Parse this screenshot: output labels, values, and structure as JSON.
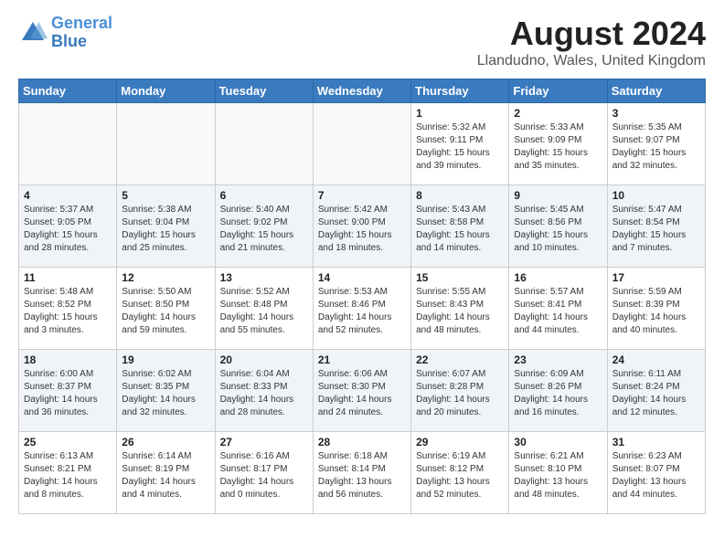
{
  "header": {
    "logo_line1": "General",
    "logo_line2": "Blue",
    "title": "August 2024",
    "subtitle": "Llandudno, Wales, United Kingdom"
  },
  "weekdays": [
    "Sunday",
    "Monday",
    "Tuesday",
    "Wednesday",
    "Thursday",
    "Friday",
    "Saturday"
  ],
  "weeks": [
    [
      {
        "day": "",
        "info": ""
      },
      {
        "day": "",
        "info": ""
      },
      {
        "day": "",
        "info": ""
      },
      {
        "day": "",
        "info": ""
      },
      {
        "day": "1",
        "info": "Sunrise: 5:32 AM\nSunset: 9:11 PM\nDaylight: 15 hours\nand 39 minutes."
      },
      {
        "day": "2",
        "info": "Sunrise: 5:33 AM\nSunset: 9:09 PM\nDaylight: 15 hours\nand 35 minutes."
      },
      {
        "day": "3",
        "info": "Sunrise: 5:35 AM\nSunset: 9:07 PM\nDaylight: 15 hours\nand 32 minutes."
      }
    ],
    [
      {
        "day": "4",
        "info": "Sunrise: 5:37 AM\nSunset: 9:05 PM\nDaylight: 15 hours\nand 28 minutes."
      },
      {
        "day": "5",
        "info": "Sunrise: 5:38 AM\nSunset: 9:04 PM\nDaylight: 15 hours\nand 25 minutes."
      },
      {
        "day": "6",
        "info": "Sunrise: 5:40 AM\nSunset: 9:02 PM\nDaylight: 15 hours\nand 21 minutes."
      },
      {
        "day": "7",
        "info": "Sunrise: 5:42 AM\nSunset: 9:00 PM\nDaylight: 15 hours\nand 18 minutes."
      },
      {
        "day": "8",
        "info": "Sunrise: 5:43 AM\nSunset: 8:58 PM\nDaylight: 15 hours\nand 14 minutes."
      },
      {
        "day": "9",
        "info": "Sunrise: 5:45 AM\nSunset: 8:56 PM\nDaylight: 15 hours\nand 10 minutes."
      },
      {
        "day": "10",
        "info": "Sunrise: 5:47 AM\nSunset: 8:54 PM\nDaylight: 15 hours\nand 7 minutes."
      }
    ],
    [
      {
        "day": "11",
        "info": "Sunrise: 5:48 AM\nSunset: 8:52 PM\nDaylight: 15 hours\nand 3 minutes."
      },
      {
        "day": "12",
        "info": "Sunrise: 5:50 AM\nSunset: 8:50 PM\nDaylight: 14 hours\nand 59 minutes."
      },
      {
        "day": "13",
        "info": "Sunrise: 5:52 AM\nSunset: 8:48 PM\nDaylight: 14 hours\nand 55 minutes."
      },
      {
        "day": "14",
        "info": "Sunrise: 5:53 AM\nSunset: 8:46 PM\nDaylight: 14 hours\nand 52 minutes."
      },
      {
        "day": "15",
        "info": "Sunrise: 5:55 AM\nSunset: 8:43 PM\nDaylight: 14 hours\nand 48 minutes."
      },
      {
        "day": "16",
        "info": "Sunrise: 5:57 AM\nSunset: 8:41 PM\nDaylight: 14 hours\nand 44 minutes."
      },
      {
        "day": "17",
        "info": "Sunrise: 5:59 AM\nSunset: 8:39 PM\nDaylight: 14 hours\nand 40 minutes."
      }
    ],
    [
      {
        "day": "18",
        "info": "Sunrise: 6:00 AM\nSunset: 8:37 PM\nDaylight: 14 hours\nand 36 minutes."
      },
      {
        "day": "19",
        "info": "Sunrise: 6:02 AM\nSunset: 8:35 PM\nDaylight: 14 hours\nand 32 minutes."
      },
      {
        "day": "20",
        "info": "Sunrise: 6:04 AM\nSunset: 8:33 PM\nDaylight: 14 hours\nand 28 minutes."
      },
      {
        "day": "21",
        "info": "Sunrise: 6:06 AM\nSunset: 8:30 PM\nDaylight: 14 hours\nand 24 minutes."
      },
      {
        "day": "22",
        "info": "Sunrise: 6:07 AM\nSunset: 8:28 PM\nDaylight: 14 hours\nand 20 minutes."
      },
      {
        "day": "23",
        "info": "Sunrise: 6:09 AM\nSunset: 8:26 PM\nDaylight: 14 hours\nand 16 minutes."
      },
      {
        "day": "24",
        "info": "Sunrise: 6:11 AM\nSunset: 8:24 PM\nDaylight: 14 hours\nand 12 minutes."
      }
    ],
    [
      {
        "day": "25",
        "info": "Sunrise: 6:13 AM\nSunset: 8:21 PM\nDaylight: 14 hours\nand 8 minutes."
      },
      {
        "day": "26",
        "info": "Sunrise: 6:14 AM\nSunset: 8:19 PM\nDaylight: 14 hours\nand 4 minutes."
      },
      {
        "day": "27",
        "info": "Sunrise: 6:16 AM\nSunset: 8:17 PM\nDaylight: 14 hours\nand 0 minutes."
      },
      {
        "day": "28",
        "info": "Sunrise: 6:18 AM\nSunset: 8:14 PM\nDaylight: 13 hours\nand 56 minutes."
      },
      {
        "day": "29",
        "info": "Sunrise: 6:19 AM\nSunset: 8:12 PM\nDaylight: 13 hours\nand 52 minutes."
      },
      {
        "day": "30",
        "info": "Sunrise: 6:21 AM\nSunset: 8:10 PM\nDaylight: 13 hours\nand 48 minutes."
      },
      {
        "day": "31",
        "info": "Sunrise: 6:23 AM\nSunset: 8:07 PM\nDaylight: 13 hours\nand 44 minutes."
      }
    ]
  ]
}
